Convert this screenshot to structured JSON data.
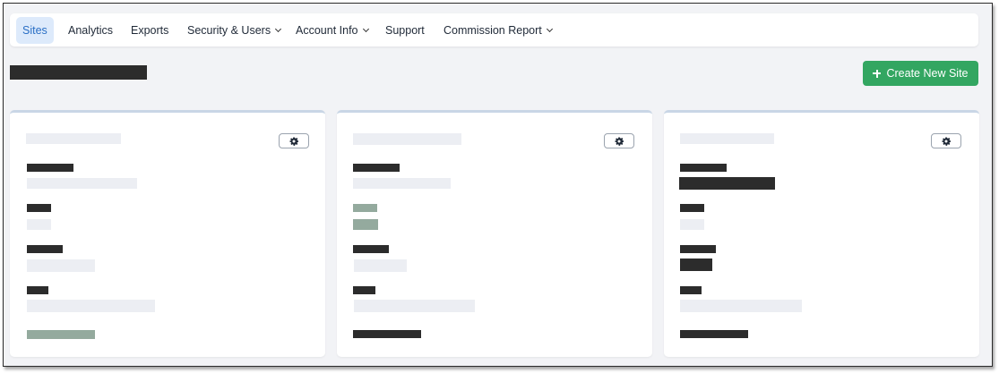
{
  "nav": {
    "items": [
      {
        "label": "Sites",
        "active": true
      },
      {
        "label": "Analytics"
      },
      {
        "label": "Exports"
      },
      {
        "label": "Security & Users",
        "dropdown": true
      },
      {
        "label": "Account Info",
        "dropdown": true
      },
      {
        "label": "Support"
      },
      {
        "label": "Commission Report",
        "dropdown": true
      }
    ]
  },
  "page": {
    "create_button_label": "Create New Site"
  },
  "colors": {
    "accent": "#2a6fc5",
    "active_tab_bg": "#ddeafb",
    "primary_button": "#33a661",
    "redaction": "#2c2c2c",
    "placeholder": "#eceef3",
    "status_green": "#94aa9e"
  },
  "icons": {
    "card_settings": "gear-icon",
    "create": "plus-icon",
    "dropdown": "chevron-down-icon"
  }
}
